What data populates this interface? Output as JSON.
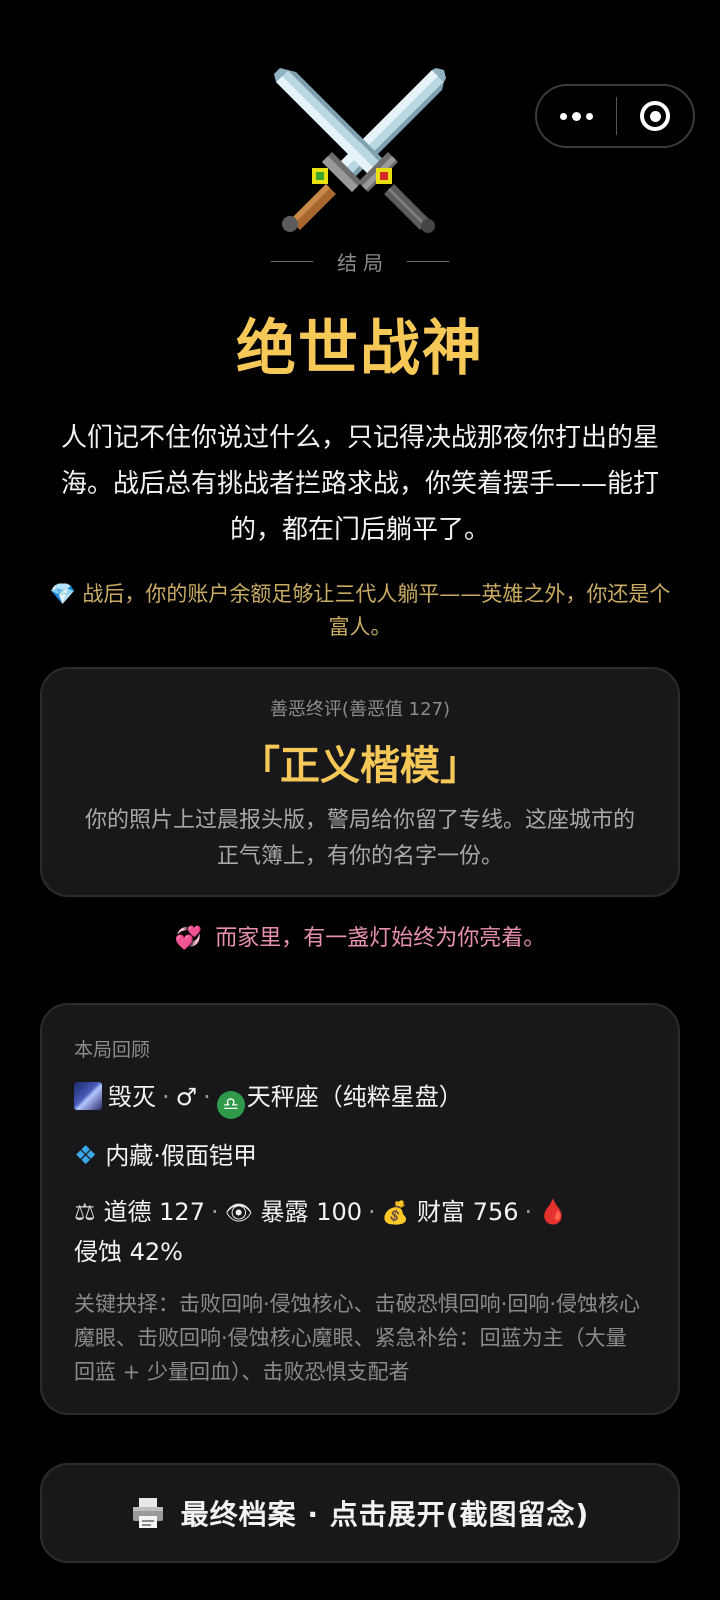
{
  "header": {
    "more_icon": "more-dots-icon",
    "close_icon": "target-close-icon"
  },
  "ending": {
    "label": "结局",
    "title": "绝世战神",
    "description": "人们记不住你说过什么，只记得决战那夜你打出的星海。战后总有挑战者拦路求战，你笑着摆手——能打的，都在门后躺平了。",
    "wealth_icon": "💎",
    "wealth_text": "战后，你的账户余额足够让三代人躺平——英雄之外，你还是个富人。"
  },
  "karma": {
    "label": "善恶终评(善恶值 127)",
    "title": "「正义楷模」",
    "description": "你的照片上过晨报头版，警局给你留了专线。这座城市的正气簿上，有你的名字一份。"
  },
  "home": {
    "icon": "💞",
    "text": "而家里，有一盏灯始终为你亮着。"
  },
  "review": {
    "label": "本局回顾",
    "origin": "毁灭",
    "gender": "♂",
    "zodiac_icon": "♎",
    "zodiac": "天秤座（纯粹星盘）",
    "hidden": "内藏·假面铠甲",
    "morality_label": "道德",
    "morality": "127",
    "exposure_label": "暴露",
    "exposure": "100",
    "wealth_label": "财富",
    "wealth": "756",
    "corruption": "侵蚀 42%",
    "key_choices": "关键抉择：击败回响·侵蚀核心、击破恐惧回响·回响·侵蚀核心魔眼、击败回响·侵蚀核心魔眼、紧急补给：回蓝为主（大量回蓝 + 少量回血）、击败恐惧支配者"
  },
  "archive_button": {
    "label": "最终档案 · 点击展开(截图留念)"
  },
  "colors": {
    "gold": "#f6c858",
    "wealth_text": "#c9ab62",
    "home_text": "#e890b0",
    "card_bg": "#18181a"
  }
}
